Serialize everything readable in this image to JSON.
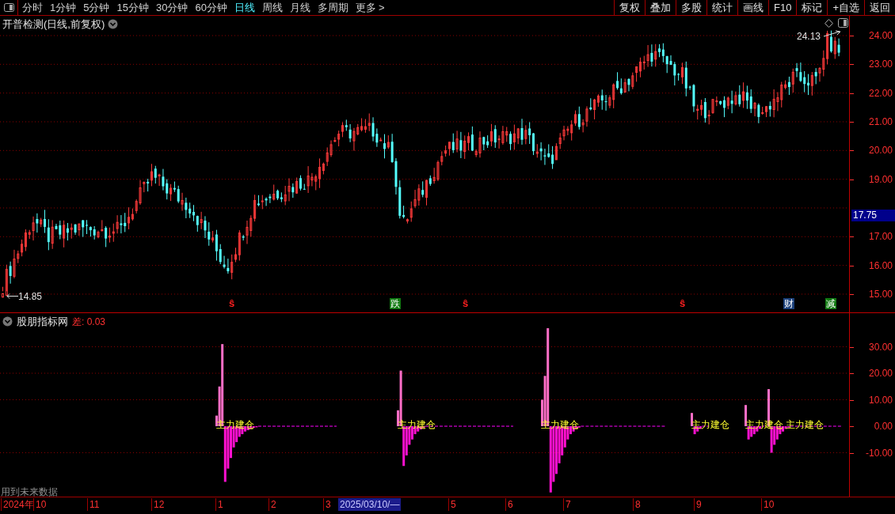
{
  "toolbar": {
    "periods": [
      {
        "label": "分时",
        "selected": false
      },
      {
        "label": "1分钟",
        "selected": false
      },
      {
        "label": "5分钟",
        "selected": false
      },
      {
        "label": "15分钟",
        "selected": false
      },
      {
        "label": "30分钟",
        "selected": false
      },
      {
        "label": "60分钟",
        "selected": false
      },
      {
        "label": "日线",
        "selected": true
      },
      {
        "label": "周线",
        "selected": false
      },
      {
        "label": "月线",
        "selected": false
      },
      {
        "label": "多周期",
        "selected": false
      },
      {
        "label": "更多",
        "selected": false
      }
    ],
    "more_arrow": ">",
    "buttons": [
      "复权",
      "叠加",
      "多股",
      "统计",
      "画线",
      "F10",
      "标记",
      "+自选",
      "返回"
    ]
  },
  "price_chart": {
    "title": "开普检测(日线,前复权)",
    "high_label": "24.13",
    "low_label": "14.85",
    "axis_ticks": [
      "24.00",
      "23.00",
      "22.00",
      "21.00",
      "20.00",
      "19.00",
      "17.00",
      "16.00",
      "15.00"
    ],
    "current_price": "17.75",
    "event_markers": [
      {
        "kind": "symbol",
        "label": "ŝ"
      },
      {
        "kind": "tag",
        "label": "跌",
        "color": "#117a11"
      },
      {
        "kind": "symbol",
        "label": "ŝ"
      },
      {
        "kind": "symbol",
        "label": "ŝ"
      },
      {
        "kind": "tag",
        "label": "财",
        "color": "#1a3f7a"
      },
      {
        "kind": "tag",
        "label": "减",
        "color": "#117a11"
      }
    ]
  },
  "indicator": {
    "name": "股朋指标网",
    "reading": "差: 0.03",
    "signal_labels": [
      "主力建仓",
      "主力建仓",
      "主力建仓",
      "主力建仓",
      "主力建仓",
      "主力建仓"
    ],
    "axis_ticks": [
      "30.00",
      "20.00",
      "10.00",
      "0.00",
      "-10.00"
    ],
    "note": "用到未来数据"
  },
  "date_axis": [
    {
      "kind": "year",
      "text": "2024年"
    },
    {
      "kind": "month",
      "text": "10"
    },
    {
      "kind": "month",
      "text": "11"
    },
    {
      "kind": "month",
      "text": "12"
    },
    {
      "kind": "month",
      "text": "1"
    },
    {
      "kind": "month",
      "text": "2"
    },
    {
      "kind": "month",
      "text": "3"
    },
    {
      "kind": "cursor",
      "text": "2025/03/10/—"
    },
    {
      "kind": "month",
      "text": "5"
    },
    {
      "kind": "month",
      "text": "6"
    },
    {
      "kind": "month",
      "text": "7"
    },
    {
      "kind": "month",
      "text": "8"
    },
    {
      "kind": "month",
      "text": "9"
    },
    {
      "kind": "month",
      "text": "10"
    }
  ]
}
